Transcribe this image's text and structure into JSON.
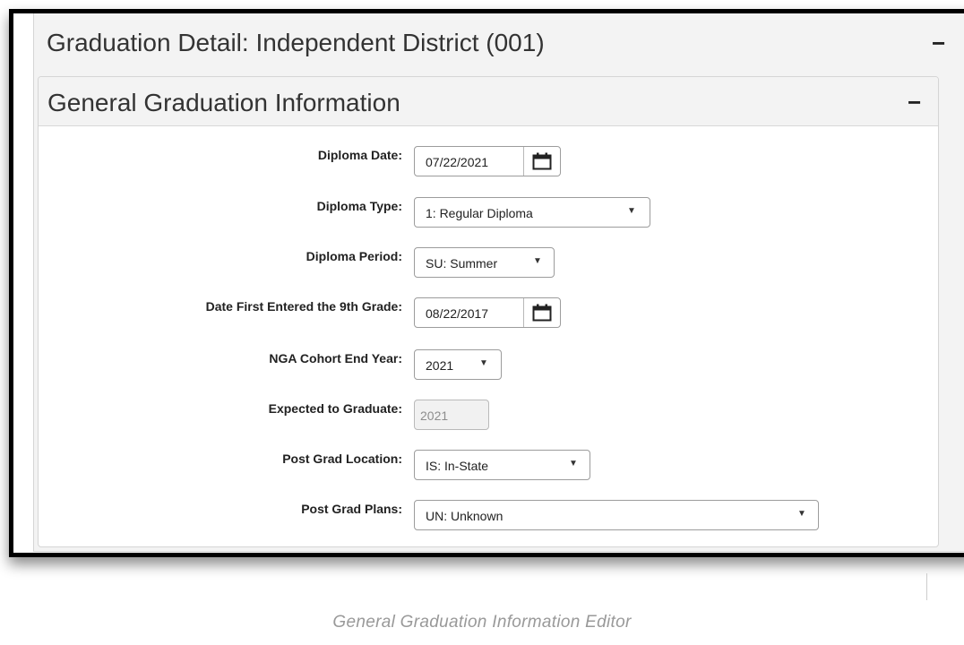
{
  "outer_panel": {
    "title": "Graduation Detail: Independent District (001)",
    "collapse": "−"
  },
  "inner_panel": {
    "title": "General Graduation Information",
    "collapse": "−"
  },
  "fields": {
    "diploma_date": {
      "label": "Diploma Date:",
      "value": "07/22/2021"
    },
    "diploma_type": {
      "label": "Diploma Type:",
      "value": "1: Regular Diploma"
    },
    "diploma_period": {
      "label": "Diploma Period:",
      "value": "SU: Summer"
    },
    "first_9th": {
      "label": "Date First Entered the 9th Grade:",
      "value": "08/22/2017"
    },
    "nga_cohort": {
      "label": "NGA Cohort End Year:",
      "value": "2021"
    },
    "expected_grad": {
      "label": "Expected to Graduate:",
      "value": "2021"
    },
    "post_grad_location": {
      "label": "Post Grad Location:",
      "value": "IS: In-State"
    },
    "post_grad_plans": {
      "label": "Post Grad Plans:",
      "value": "UN: Unknown"
    }
  },
  "caption": "General Graduation Information Editor",
  "icons": {
    "calendar": "calendar-icon",
    "dropdown": "▼"
  },
  "colors": {
    "panel_header": "#f3f3f3",
    "border": "#9c9c9c",
    "caption": "#999999"
  }
}
